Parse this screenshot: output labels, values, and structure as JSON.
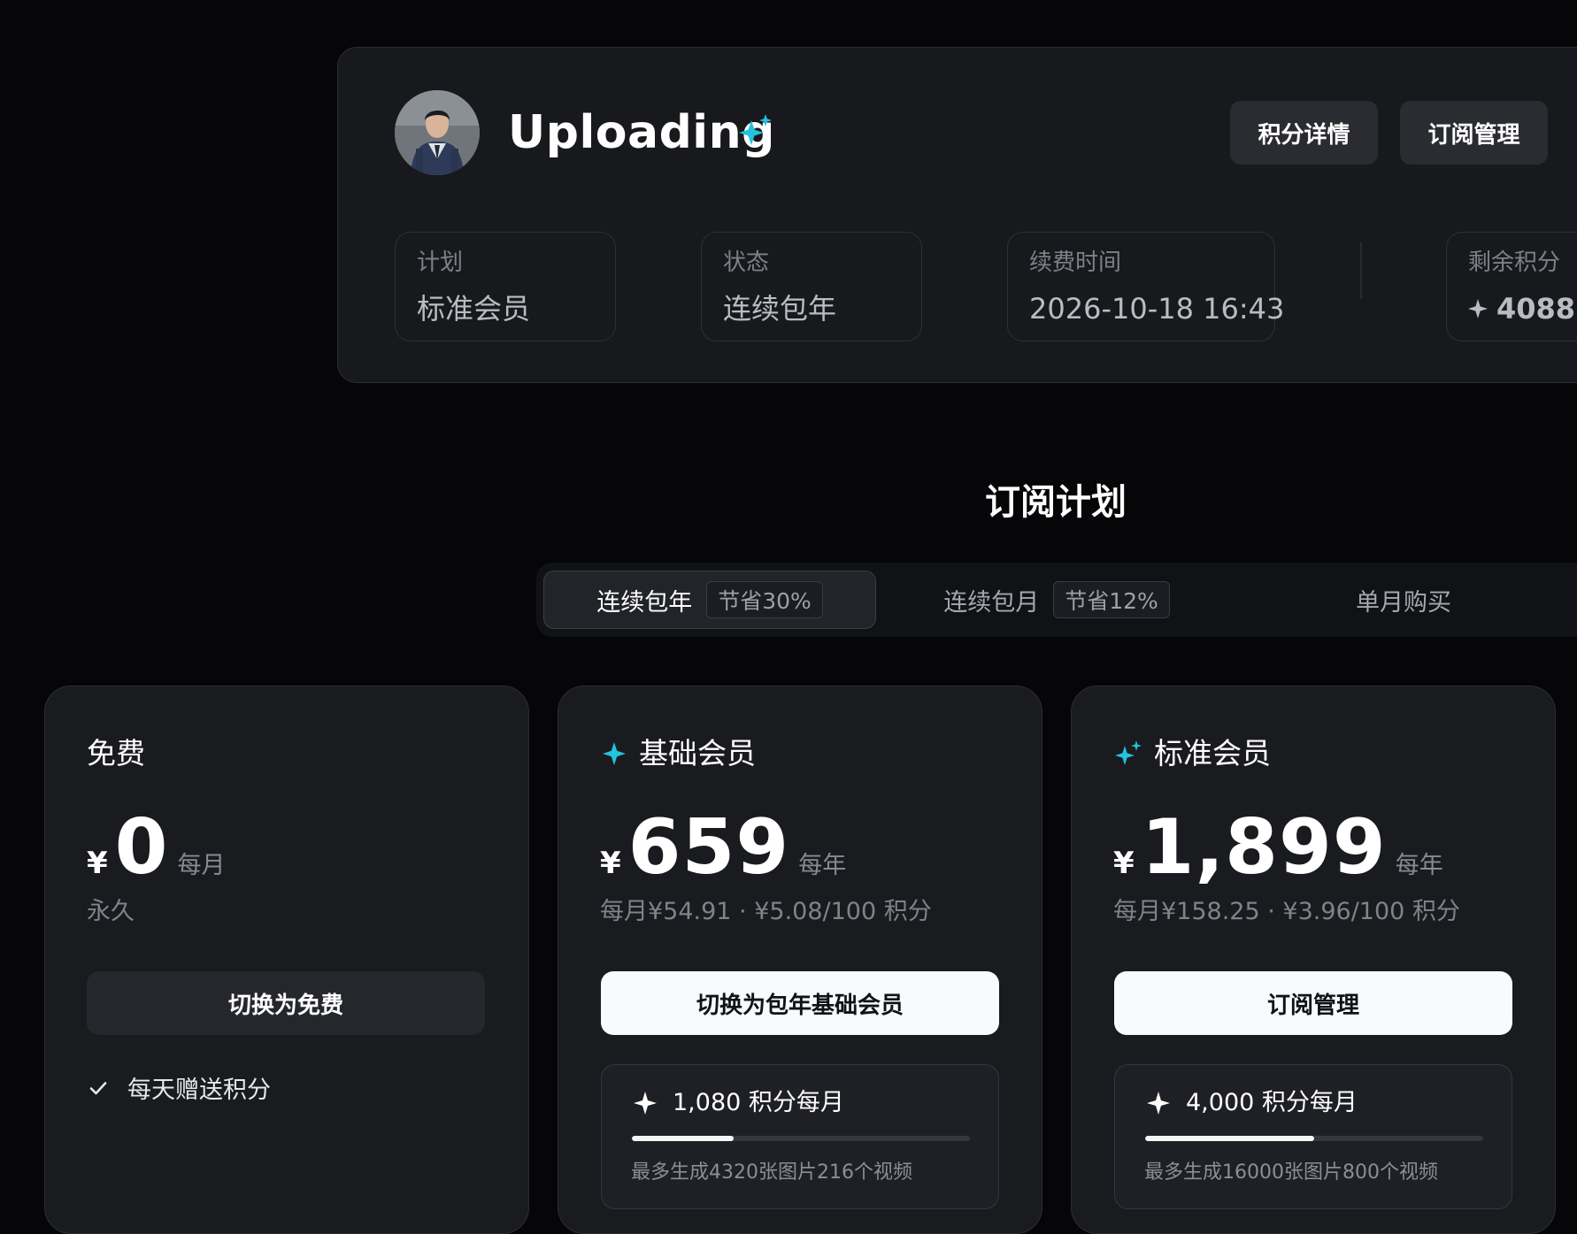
{
  "profile": {
    "username": "Uploading",
    "buttons": [
      "积分详情",
      "订阅管理"
    ],
    "info": {
      "plan_label": "计划",
      "plan_value": "标准会员",
      "status_label": "状态",
      "status_value": "连续包年",
      "renew_label": "续费时间",
      "renew_value": "2026-10-18 16:43",
      "credits_label": "剩余积分",
      "credits_value": "4088"
    }
  },
  "section_title": "订阅计划",
  "tabs": [
    {
      "label": "连续包年",
      "badge": "节省30%",
      "active": true
    },
    {
      "label": "连续包月",
      "badge": "节省12%",
      "active": false
    },
    {
      "label": "单月购买",
      "badge": "",
      "active": false
    }
  ],
  "plans": [
    {
      "name": "免费",
      "currency": "¥",
      "price": "0",
      "period": "每月",
      "sub": "永久",
      "button": "切换为免费",
      "feature": "每天赠送积分"
    },
    {
      "name": "基础会员",
      "currency": "¥",
      "price": "659",
      "period": "每年",
      "sub": "每月¥54.91 · ¥5.08/100 积分",
      "button": "切换为包年基础会员",
      "credits": "1,080 积分每月",
      "credits_progress": 0.3,
      "credits_note": "最多生成4320张图片216个视频"
    },
    {
      "name": "标准会员",
      "currency": "¥",
      "price": "1,899",
      "period": "每年",
      "sub": "每月¥158.25 · ¥3.96/100 积分",
      "button": "订阅管理",
      "credits": "4,000 积分每月",
      "credits_progress": 0.5,
      "credits_note": "最多生成16000张图片800个视频"
    }
  ],
  "colors": {
    "accent": "#22c3dd",
    "background": "#060608",
    "card": "#1a1b1f"
  },
  "icons": {
    "username_badge": "sparkles-icon",
    "credits": "sparkle-icon",
    "check": "check-icon"
  }
}
